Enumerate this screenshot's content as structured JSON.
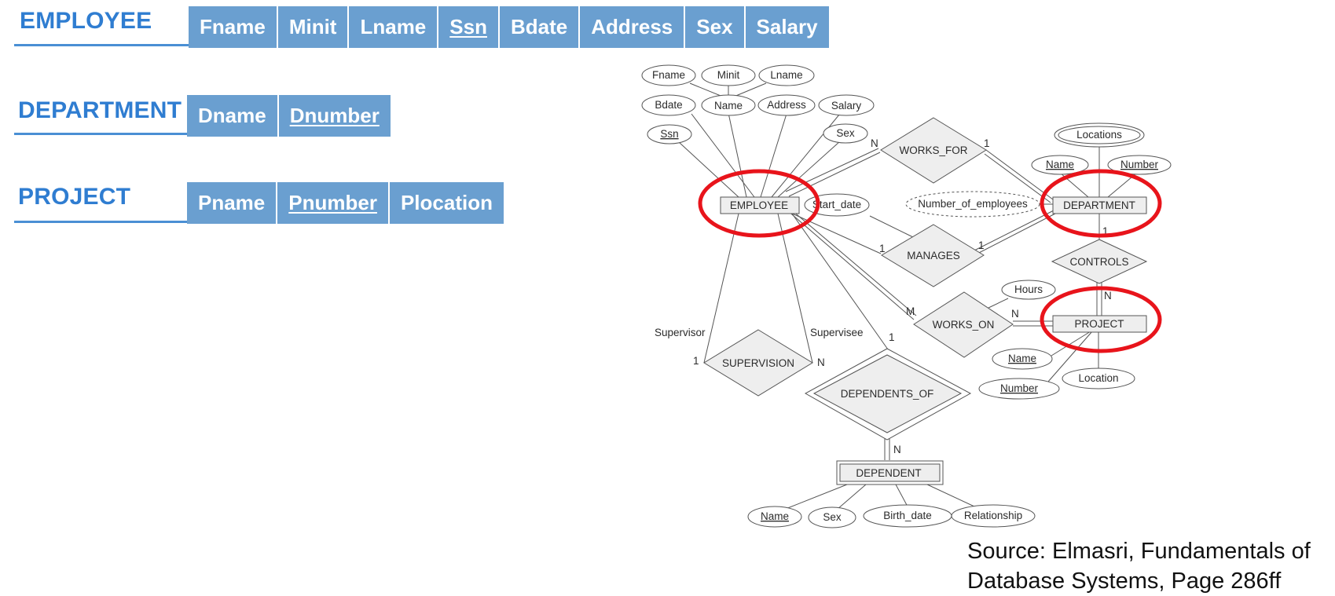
{
  "relations": [
    {
      "name": "EMPLOYEE",
      "attributes": [
        {
          "label": "Fname",
          "key": false
        },
        {
          "label": "Minit",
          "key": false
        },
        {
          "label": "Lname",
          "key": false
        },
        {
          "label": "Ssn",
          "key": true
        },
        {
          "label": "Bdate",
          "key": false
        },
        {
          "label": "Address",
          "key": false
        },
        {
          "label": "Sex",
          "key": false
        },
        {
          "label": "Salary",
          "key": false
        }
      ]
    },
    {
      "name": "DEPARTMENT",
      "attributes": [
        {
          "label": "Dname",
          "key": false
        },
        {
          "label": "Dnumber",
          "key": true
        }
      ]
    },
    {
      "name": "PROJECT",
      "attributes": [
        {
          "label": "Pname",
          "key": false
        },
        {
          "label": "Pnumber",
          "key": true
        },
        {
          "label": "Plocation",
          "key": false
        }
      ]
    }
  ],
  "er": {
    "entities": {
      "employee": "EMPLOYEE",
      "department": "DEPARTMENT",
      "project": "PROJECT",
      "dependent": "DEPENDENT"
    },
    "relationships": {
      "works_for": "WORKS_FOR",
      "manages": "MANAGES",
      "controls": "CONTROLS",
      "works_on": "WORKS_ON",
      "supervision": "SUPERVISION",
      "dependents_of": "DEPENDENTS_OF"
    },
    "attributes": {
      "emp_fname": "Fname",
      "emp_minit": "Minit",
      "emp_lname": "Lname",
      "emp_bdate": "Bdate",
      "emp_name": "Name",
      "emp_address": "Address",
      "emp_salary": "Salary",
      "emp_ssn": "Ssn",
      "emp_sex": "Sex",
      "dept_locations": "Locations",
      "dept_name": "Name",
      "dept_number": "Number",
      "num_employees": "Number_of_employees",
      "start_date": "Start_date",
      "hours": "Hours",
      "proj_name": "Name",
      "proj_number": "Number",
      "proj_location": "Location",
      "dep_name": "Name",
      "dep_sex": "Sex",
      "dep_birth_date": "Birth_date",
      "dep_relationship": "Relationship"
    },
    "roles": {
      "supervisor": "Supervisor",
      "supervisee": "Supervisee"
    },
    "cardinalities": {
      "wf_emp": "N",
      "wf_dept": "1",
      "mg_emp": "1",
      "mg_dept": "1",
      "ct_dept": "1",
      "ct_proj": "N",
      "wo_emp": "M",
      "wo_proj": "N",
      "sup_supervisor": "1",
      "sup_supervisee": "N",
      "dep_emp": "1",
      "dep_dependent": "N"
    }
  },
  "highlight_color": "#e8141b",
  "source": {
    "line1": "Source: Elmasri, Fundamentals of",
    "line2": "Database Systems, Page 286ff"
  }
}
